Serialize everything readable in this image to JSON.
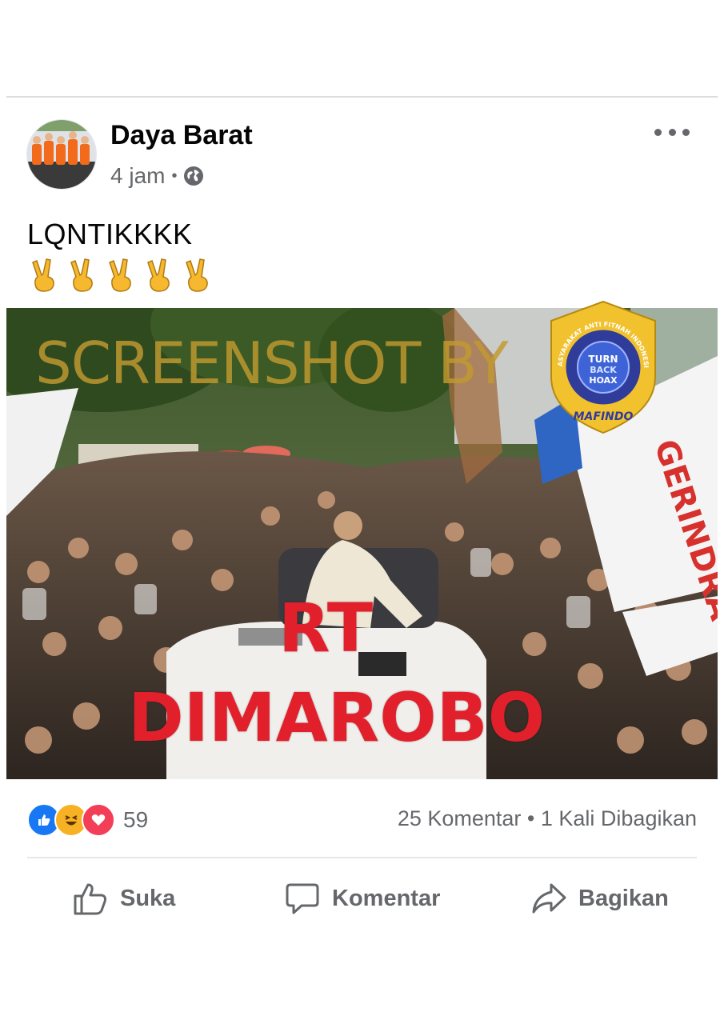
{
  "post": {
    "author": "Daya Barat",
    "time": "4 jam",
    "separator": "•",
    "privacy_icon": "globe-icon",
    "menu_icon": "more-horizontal-icon",
    "caption": "LQNTIKKKK",
    "caption_emojis": [
      "victory-hand-emoji",
      "victory-hand-emoji",
      "victory-hand-emoji",
      "victory-hand-emoji",
      "victory-hand-emoji"
    ]
  },
  "photo": {
    "watermark_text": "SCREENSHOT BY",
    "overlay_line1": "RT",
    "overlay_line2": "DIMAROBO",
    "badge": {
      "ring_text": "MASYARAKAT ANTI FITNAH INDONESIA",
      "center_line1": "TURN",
      "center_line2": "BACK",
      "center_line3": "HOAX",
      "bottom_text": "MAFINDO"
    },
    "banner_text": "GERINDRA"
  },
  "stats": {
    "reactions": [
      "like-reaction-icon",
      "haha-reaction-icon",
      "love-reaction-icon"
    ],
    "reaction_count": "59",
    "comments_shares": "25 Komentar • 1 Kali Dibagikan"
  },
  "actions": {
    "like_label": "Suka",
    "comment_label": "Komentar",
    "share_label": "Bagikan"
  },
  "colors": {
    "overlay_red": "#e2202c",
    "watermark_gold": "#c29a2f",
    "secondary_text": "#65676b",
    "like_blue": "#1877f2",
    "love_red": "#f33e58",
    "haha_yellow": "#f7b125"
  }
}
